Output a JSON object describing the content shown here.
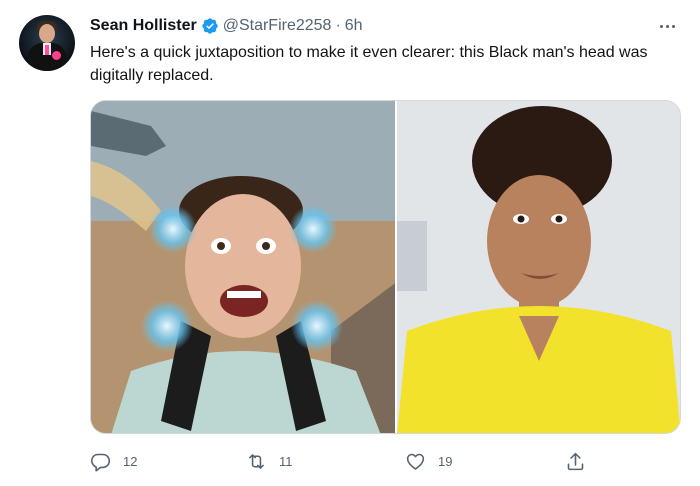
{
  "author": {
    "name": "Sean Hollister",
    "handle": "@StarFire2258",
    "separator": "·",
    "time": "6h",
    "verified": true
  },
  "tweet": {
    "text": "Here's a quick juxtaposition to make it even clearer: this Black man's head was digitally replaced."
  },
  "actions": {
    "replies": "12",
    "retweets": "11",
    "likes": "19"
  },
  "colors": {
    "verified_blue": "#1d9bf0",
    "secondary_text": "#536471",
    "primary_text": "#0f1419",
    "border": "#cfd9de"
  },
  "icons": {
    "reply": "reply-icon",
    "retweet": "retweet-icon",
    "like": "heart-icon",
    "share": "share-icon",
    "more": "more-icon",
    "verified": "verified-badge-icon"
  }
}
